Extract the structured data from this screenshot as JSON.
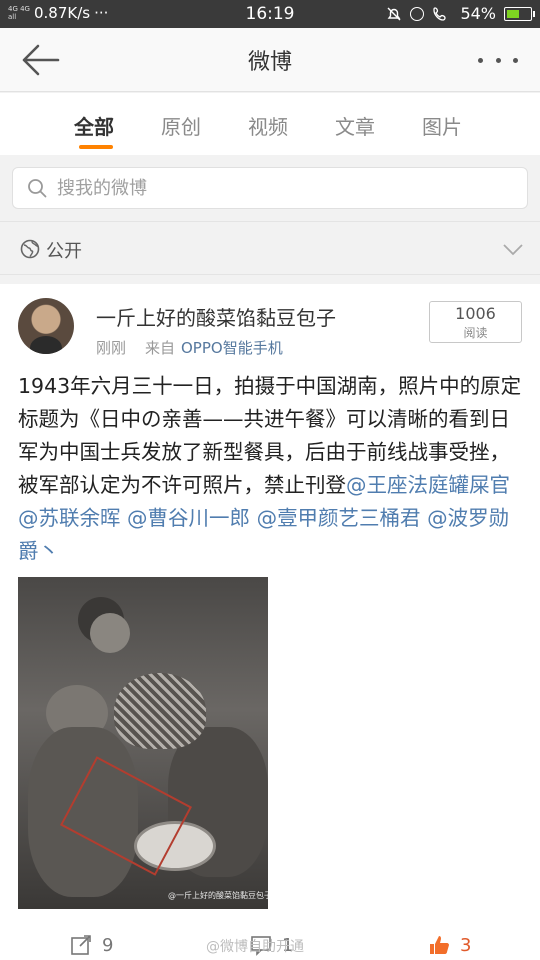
{
  "status_bar": {
    "network_tiny_top": "4G 4G",
    "network_tiny_bottom": "all",
    "speed": "0.87K/s",
    "dots": "···",
    "time": "16:19",
    "battery": "54%"
  },
  "nav": {
    "title": "微博"
  },
  "tabs": [
    "全部",
    "原创",
    "视频",
    "文章",
    "图片"
  ],
  "search": {
    "placeholder": "搜我的微博"
  },
  "visibility": {
    "label": "公开"
  },
  "post": {
    "user_name": "一斤上好的酸菜馅黏豆包子",
    "time": "刚刚",
    "source_label": "来自",
    "source": "OPPO智能手机",
    "read_count": "1006",
    "read_label": "阅读",
    "text": "1943年六月三十一日，拍摄于中国湖南，照片中的原定标题为《日中の亲善——共进午餐》可以清晰的看到日军为中国士兵发放了新型餐具，后由于前线战事受挫，被军部认定为不许可照片，禁止刊登",
    "mentions": [
      "@王座法庭罐屎官",
      "@苏联余晖",
      "@曹谷川一郎",
      "@壹甲颜艺三桶君",
      "@波罗勋爵丶"
    ],
    "image_watermark": "@一斤上好的酸菜馅黏豆包子",
    "repost_count": "9",
    "comment_count": "1",
    "like_count": "3",
    "page_watermark": "@微博自助开通"
  }
}
